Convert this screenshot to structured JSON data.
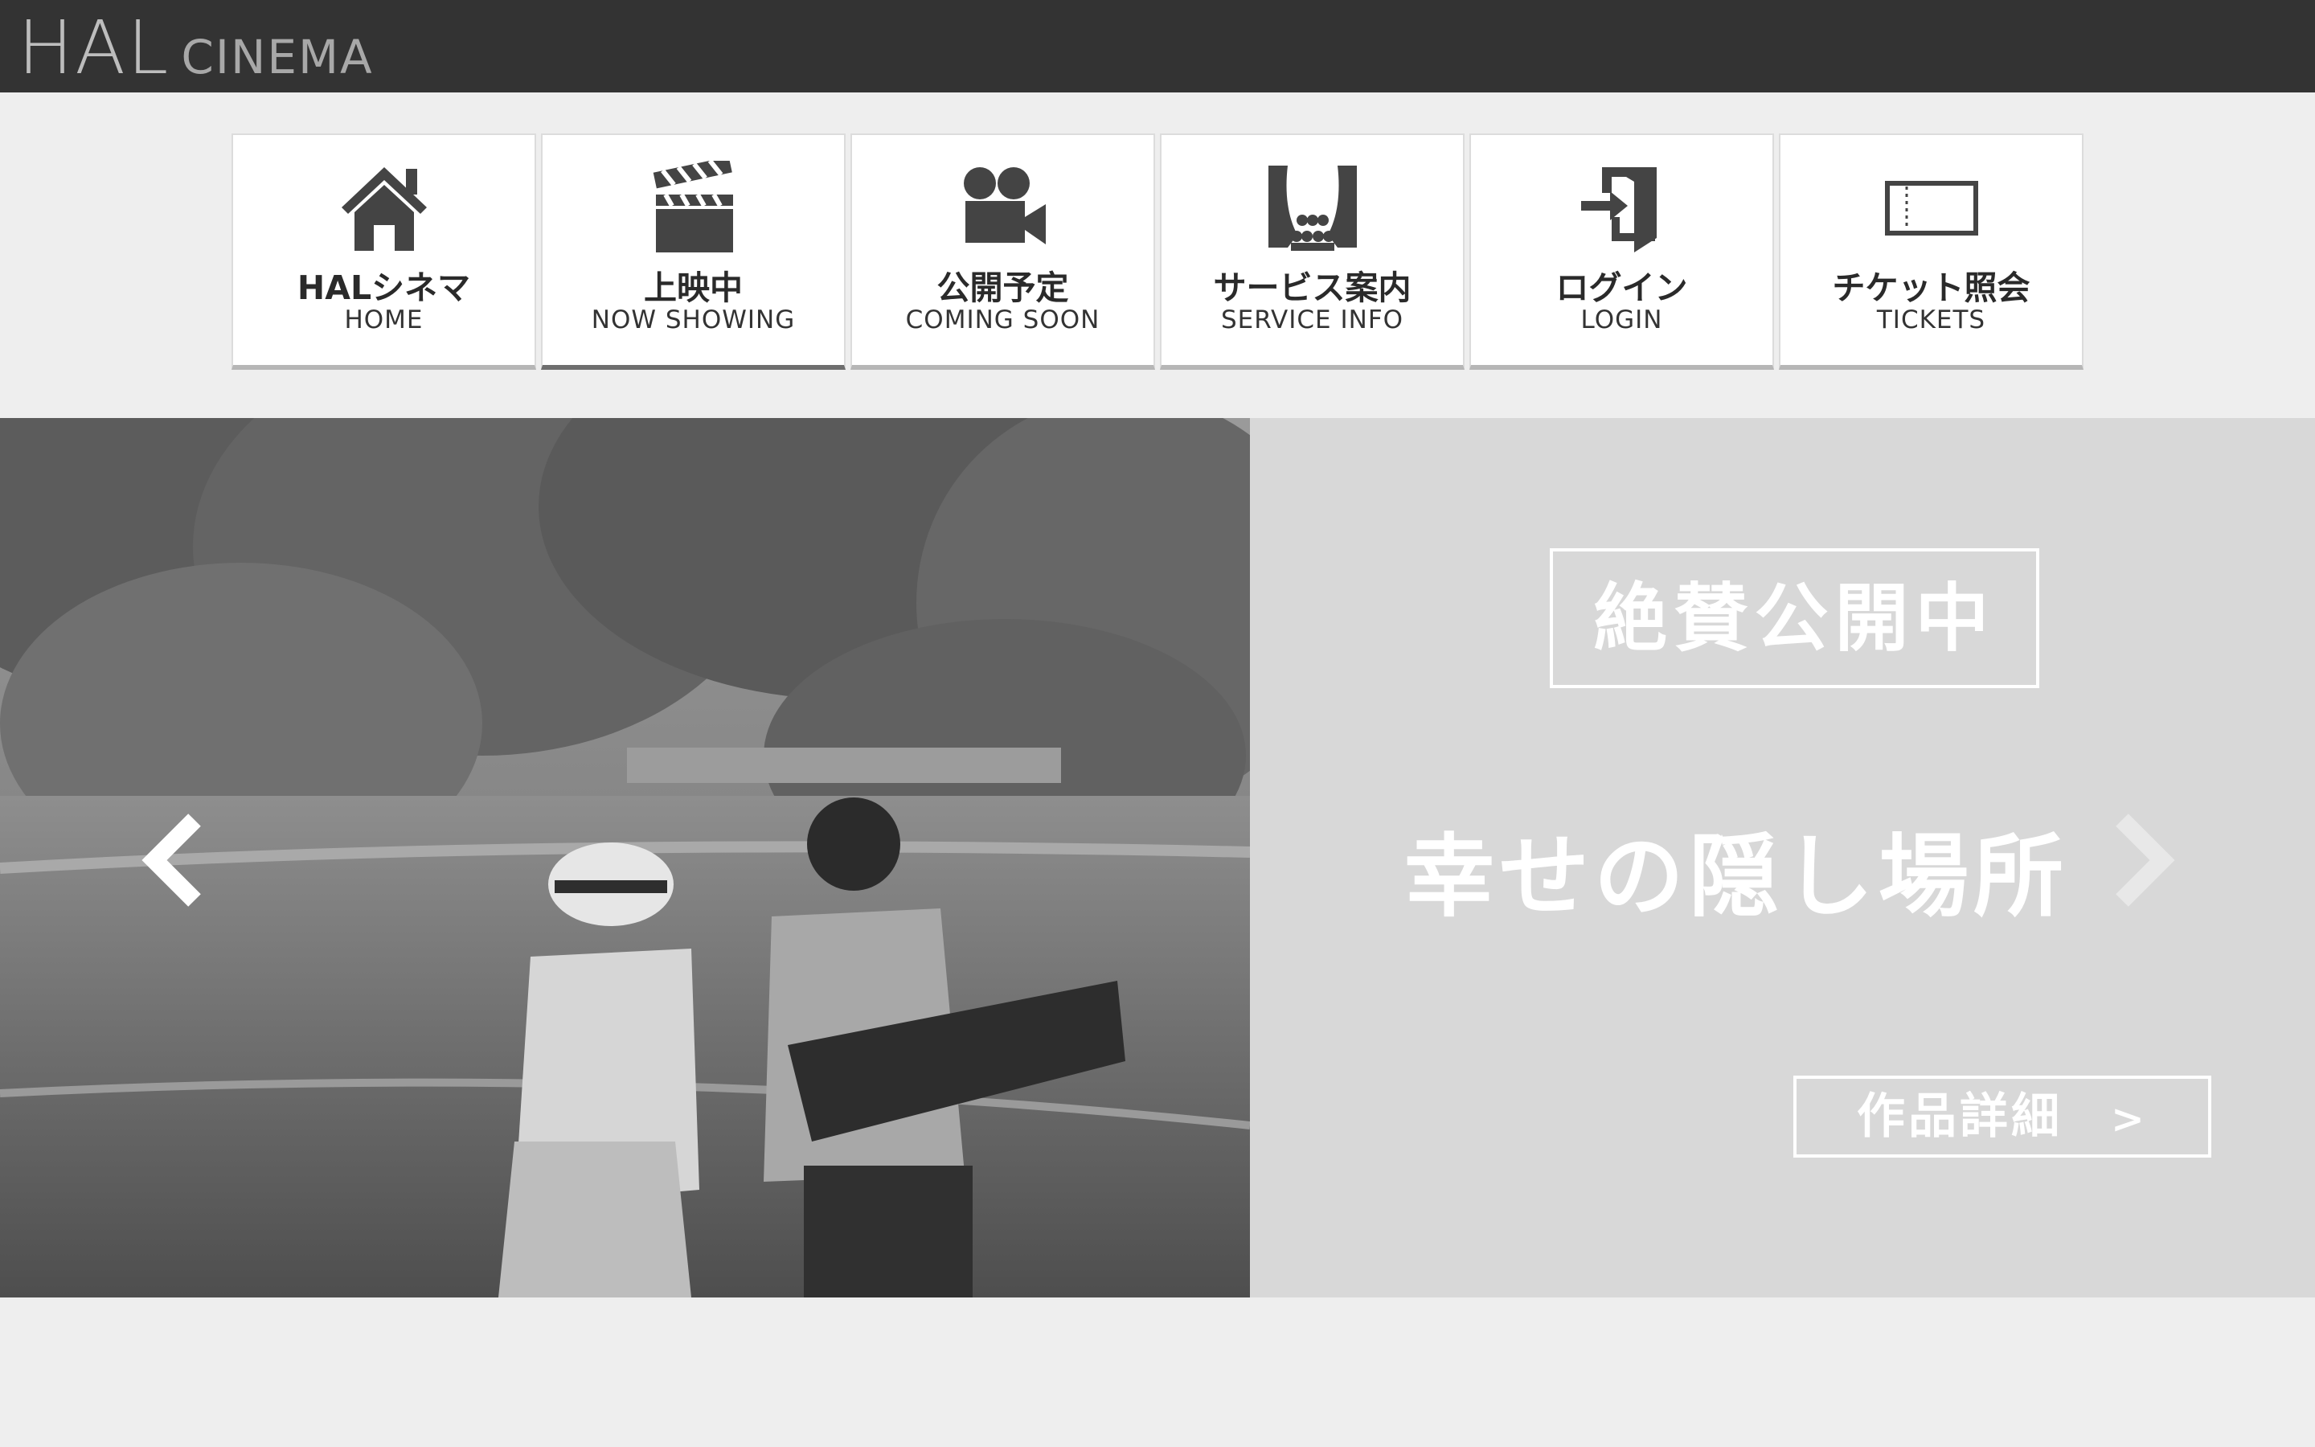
{
  "header": {
    "brand_main": "HAL",
    "brand_sub": "CINEMA"
  },
  "nav": {
    "items": [
      {
        "ja": "HALシネマ",
        "en": "HOME",
        "icon": "home-icon"
      },
      {
        "ja": "上映中",
        "en": "NOW SHOWING",
        "icon": "clapperboard-icon"
      },
      {
        "ja": "公開予定",
        "en": "COMING SOON",
        "icon": "video-camera-icon"
      },
      {
        "ja": "サービス案内",
        "en": "SERVICE INFO",
        "icon": "theater-icon"
      },
      {
        "ja": "ログイン",
        "en": "LOGIN",
        "icon": "login-icon"
      },
      {
        "ja": "チケット照会",
        "en": "TICKETS",
        "icon": "ticket-icon"
      }
    ],
    "active_index": 1
  },
  "hero": {
    "badge": "絶賛公開中",
    "movie_title": "幸せの隠し場所",
    "detail_button": "作品詳細",
    "detail_arrow": ">",
    "prev_icon": "chevron-left-icon",
    "next_icon": "chevron-right-icon"
  },
  "colors": {
    "header_bg": "#333333",
    "page_bg": "#eeeeee",
    "panel_bg": "#d8d8d8",
    "text_white": "#ffffff"
  }
}
